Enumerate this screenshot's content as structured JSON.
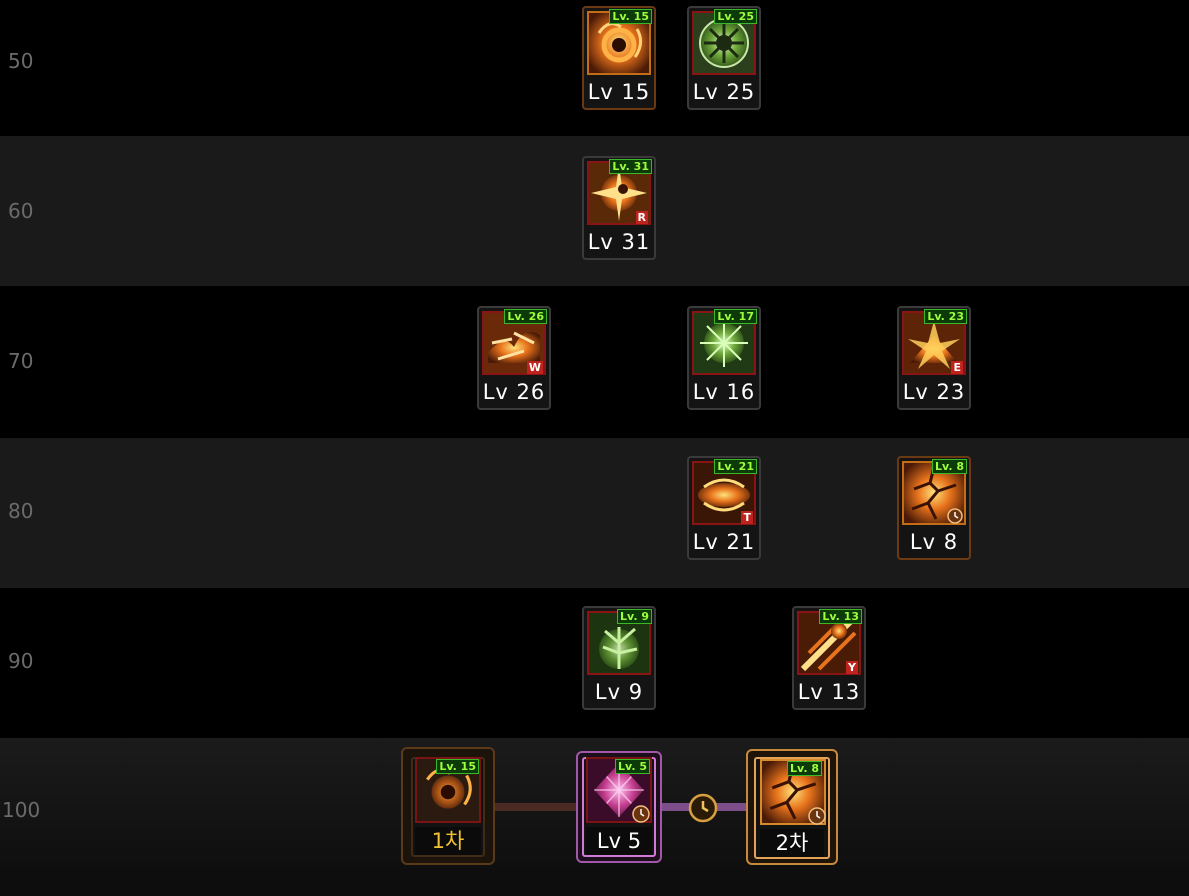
{
  "rows": [
    {
      "level": "50"
    },
    {
      "level": "60"
    },
    {
      "level": "70"
    },
    {
      "level": "80"
    },
    {
      "level": "90"
    },
    {
      "level": "100"
    }
  ],
  "skills": {
    "r50_a": {
      "tag": "Lv. 15",
      "label": "Lv 15"
    },
    "r50_b": {
      "tag": "Lv. 25",
      "label": "Lv 25"
    },
    "r60_a": {
      "tag": "Lv. 31",
      "label": "Lv 31",
      "hotkey": "R"
    },
    "r70_a": {
      "tag": "Lv. 26",
      "label": "Lv 26",
      "hotkey": "W"
    },
    "r70_b": {
      "tag": "Lv. 17",
      "label": "Lv 16"
    },
    "r70_c": {
      "tag": "Lv. 23",
      "label": "Lv 23",
      "hotkey": "E"
    },
    "r80_a": {
      "tag": "Lv. 21",
      "label": "Lv 21",
      "hotkey": "T"
    },
    "r80_b": {
      "tag": "Lv. 8",
      "label": "Lv 8"
    },
    "r90_a": {
      "tag": "Lv. 9",
      "label": "Lv 9"
    },
    "r90_b": {
      "tag": "Lv. 13",
      "label": "Lv 13",
      "hotkey": "Y"
    },
    "r100_first": {
      "tag": "Lv. 15",
      "label": "1차"
    },
    "r100_mid": {
      "tag": "Lv. 5",
      "label": "Lv 5"
    },
    "r100_second": {
      "tag": "Lv. 8",
      "label": "2차"
    }
  },
  "colors": {
    "row_dark": "#000000",
    "row_light": "#1a1a1a",
    "level_text": "#6b6b6b",
    "tag_green": "#9dff3c",
    "hotkey_red": "#c0231e",
    "tier_gold": "#f2c230",
    "purple_frame": "#d07ad6"
  },
  "icons": {
    "r50_a": "fire-swirl-icon",
    "r50_b": "green-rune-icon",
    "r60_a": "sun-burst-icon",
    "r70_a": "flame-dash-icon",
    "r70_b": "green-burst-icon",
    "r70_c": "flame-burst-icon",
    "r80_a": "flame-wave-icon",
    "r80_b": "flame-crack-icon",
    "r90_a": "green-tree-icon",
    "r90_b": "flame-slash-icon",
    "r100_first": "fire-swirl-icon",
    "r100_mid": "pink-crystal-icon",
    "r100_second": "flame-crack-icon"
  }
}
